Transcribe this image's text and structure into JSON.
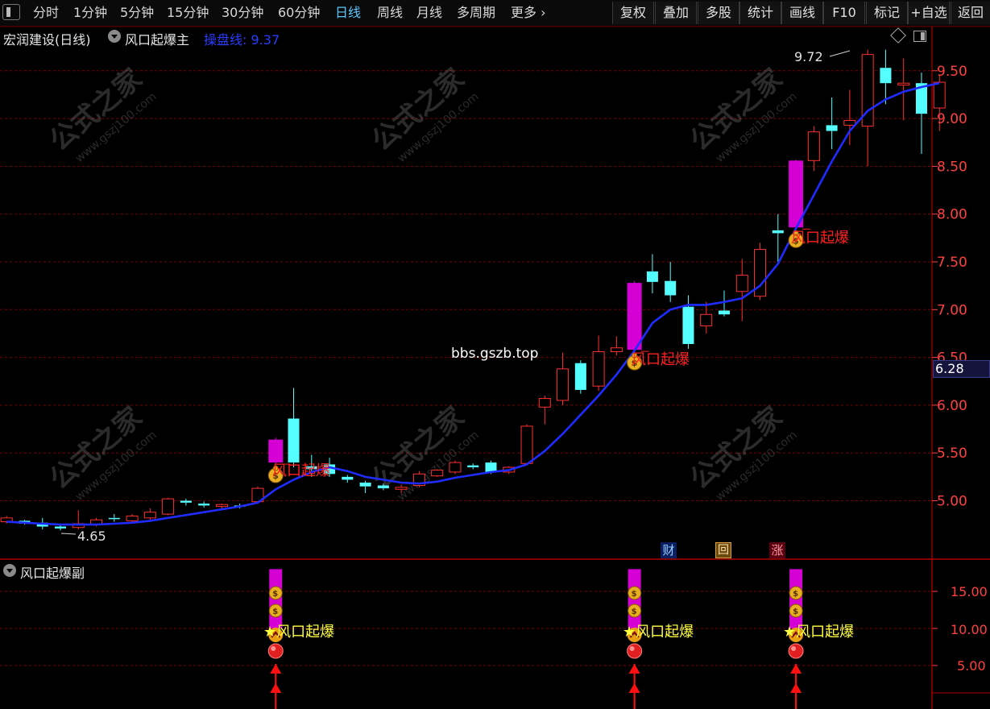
{
  "toolbar": {
    "periods": [
      "分时",
      "1分钟",
      "5分钟",
      "15分钟",
      "30分钟",
      "60分钟",
      "日线",
      "周线",
      "月线",
      "多周期",
      "更多"
    ],
    "active_period": "日线",
    "more_arrow": "›",
    "right_buttons": [
      "复权",
      "叠加",
      "多股",
      "统计",
      "画线",
      "F10",
      "标记",
      "+自选",
      "返回"
    ]
  },
  "main_panel": {
    "stock_title": "宏润建设(日线)",
    "indicator_name": "风口起爆主",
    "line_label": "操盘线",
    "line_value": "9.37",
    "high_marker": "9.72",
    "low_marker": "4.65",
    "current_price": "6.28",
    "watermark_site": "bbs.gszb.top",
    "watermark_text": "公式之家",
    "watermark_url": "www.gszj100.com",
    "signal_label": "风口起爆",
    "event_badges": [
      "财",
      "回",
      "涨"
    ]
  },
  "sub_panel": {
    "indicator_name": "风口起爆副",
    "signal_label": "风口起爆",
    "axis_ticks": [
      "15.00",
      "10.00",
      "5.00"
    ]
  },
  "colors": {
    "up": "#ff3030",
    "down": "#54ffff",
    "signal": "#d400d4",
    "ma_line": "#1f2cff",
    "grid": "#7a0000",
    "axis_text": "#ff4040",
    "label_red": "#ff2020",
    "label_yellow": "#ffff40"
  },
  "chart_data": {
    "type": "candlestick",
    "y_ticks": [
      "9.50",
      "9.00",
      "8.50",
      "8.00",
      "7.50",
      "7.00",
      "6.50",
      "6.00",
      "5.50",
      "5.00"
    ],
    "candles": [
      {
        "o": 4.78,
        "c": 4.82,
        "h": 4.84,
        "l": 4.76
      },
      {
        "o": 4.79,
        "c": 4.76,
        "h": 4.8,
        "l": 4.75
      },
      {
        "o": 4.77,
        "c": 4.73,
        "h": 4.82,
        "l": 4.7
      },
      {
        "o": 4.73,
        "c": 4.71,
        "h": 4.75,
        "l": 4.69
      },
      {
        "o": 4.72,
        "c": 4.76,
        "h": 4.9,
        "l": 4.7
      },
      {
        "o": 4.75,
        "c": 4.8,
        "h": 4.82,
        "l": 4.73
      },
      {
        "o": 4.82,
        "c": 4.81,
        "h": 4.86,
        "l": 4.78
      },
      {
        "o": 4.79,
        "c": 4.84,
        "h": 4.86,
        "l": 4.77
      },
      {
        "o": 4.82,
        "c": 4.88,
        "h": 4.92,
        "l": 4.8
      },
      {
        "o": 4.86,
        "c": 5.02,
        "h": 5.03,
        "l": 4.85
      },
      {
        "o": 5.0,
        "c": 4.98,
        "h": 5.02,
        "l": 4.95
      },
      {
        "o": 4.97,
        "c": 4.95,
        "h": 4.99,
        "l": 4.93
      },
      {
        "o": 4.94,
        "c": 4.96,
        "h": 4.97,
        "l": 4.92
      },
      {
        "o": 4.95,
        "c": 4.94,
        "h": 4.97,
        "l": 4.92
      },
      {
        "o": 4.99,
        "c": 5.13,
        "h": 5.15,
        "l": 4.98
      },
      {
        "o": 5.4,
        "c": 5.64,
        "h": 5.66,
        "l": 5.38
      },
      {
        "o": 5.86,
        "c": 5.4,
        "h": 6.18,
        "l": 5.35
      },
      {
        "o": 5.36,
        "c": 5.33,
        "h": 5.48,
        "l": 5.25
      },
      {
        "o": 5.38,
        "c": 5.28,
        "h": 5.45,
        "l": 5.25
      },
      {
        "o": 5.25,
        "c": 5.22,
        "h": 5.27,
        "l": 5.19
      },
      {
        "o": 5.19,
        "c": 5.15,
        "h": 5.21,
        "l": 5.08
      },
      {
        "o": 5.16,
        "c": 5.13,
        "h": 5.18,
        "l": 5.11
      },
      {
        "o": 5.12,
        "c": 5.14,
        "h": 5.17,
        "l": 5.08
      },
      {
        "o": 5.16,
        "c": 5.28,
        "h": 5.31,
        "l": 5.14
      },
      {
        "o": 5.26,
        "c": 5.32,
        "h": 5.33,
        "l": 5.25
      },
      {
        "o": 5.3,
        "c": 5.4,
        "h": 5.42,
        "l": 5.28
      },
      {
        "o": 5.37,
        "c": 5.35,
        "h": 5.39,
        "l": 5.33
      },
      {
        "o": 5.4,
        "c": 5.3,
        "h": 5.42,
        "l": 5.28
      },
      {
        "o": 5.3,
        "c": 5.35,
        "h": 5.36,
        "l": 5.28
      },
      {
        "o": 5.39,
        "c": 5.78,
        "h": 5.8,
        "l": 5.37
      },
      {
        "o": 5.98,
        "c": 6.07,
        "h": 6.1,
        "l": 5.8
      },
      {
        "o": 6.05,
        "c": 6.38,
        "h": 6.55,
        "l": 6.0
      },
      {
        "o": 6.44,
        "c": 6.16,
        "h": 6.47,
        "l": 6.12
      },
      {
        "o": 6.2,
        "c": 6.56,
        "h": 6.73,
        "l": 6.15
      },
      {
        "o": 6.56,
        "c": 6.6,
        "h": 6.72,
        "l": 6.52
      },
      {
        "o": 6.58,
        "c": 7.28,
        "h": 7.3,
        "l": 6.55
      },
      {
        "o": 7.4,
        "c": 7.29,
        "h": 7.58,
        "l": 7.17
      },
      {
        "o": 7.3,
        "c": 7.15,
        "h": 7.5,
        "l": 7.08
      },
      {
        "o": 7.03,
        "c": 6.64,
        "h": 7.15,
        "l": 6.59
      },
      {
        "o": 6.83,
        "c": 6.95,
        "h": 7.08,
        "l": 6.75
      },
      {
        "o": 6.99,
        "c": 6.95,
        "h": 7.2,
        "l": 6.93
      },
      {
        "o": 7.19,
        "c": 7.36,
        "h": 7.53,
        "l": 6.88
      },
      {
        "o": 7.14,
        "c": 7.63,
        "h": 7.7,
        "l": 7.1
      },
      {
        "o": 7.83,
        "c": 7.8,
        "h": 8.0,
        "l": 7.5
      },
      {
        "o": 7.86,
        "c": 8.56,
        "h": 8.57,
        "l": 7.84
      },
      {
        "o": 8.56,
        "c": 8.86,
        "h": 8.92,
        "l": 8.45
      },
      {
        "o": 8.93,
        "c": 8.87,
        "h": 9.22,
        "l": 8.68
      },
      {
        "o": 8.93,
        "c": 8.98,
        "h": 9.3,
        "l": 8.72
      },
      {
        "o": 8.92,
        "c": 9.67,
        "h": 9.72,
        "l": 8.5
      },
      {
        "o": 9.53,
        "c": 9.37,
        "h": 9.72,
        "l": 9.15
      },
      {
        "o": 9.35,
        "c": 9.37,
        "h": 9.63,
        "l": 8.98
      },
      {
        "o": 9.37,
        "c": 9.05,
        "h": 9.48,
        "l": 8.63
      },
      {
        "o": 9.11,
        "c": 9.38,
        "h": 9.45,
        "l": 8.87
      }
    ],
    "ma_line": [
      4.78,
      4.77,
      4.76,
      4.75,
      4.75,
      4.75,
      4.76,
      4.77,
      4.79,
      4.82,
      4.85,
      4.88,
      4.91,
      4.94,
      4.98,
      5.12,
      5.22,
      5.3,
      5.35,
      5.31,
      5.25,
      5.22,
      5.19,
      5.18,
      5.2,
      5.24,
      5.27,
      5.3,
      5.32,
      5.38,
      5.52,
      5.7,
      5.9,
      6.1,
      6.32,
      6.57,
      6.86,
      7.0,
      7.05,
      7.05,
      7.08,
      7.12,
      7.25,
      7.48,
      7.85,
      8.2,
      8.55,
      8.87,
      9.08,
      9.2,
      9.28,
      9.33,
      9.37
    ],
    "signal_candles": [
      15,
      35,
      44
    ],
    "sub_signal_value": 10.0,
    "sub_ylim": [
      0,
      20
    ]
  }
}
